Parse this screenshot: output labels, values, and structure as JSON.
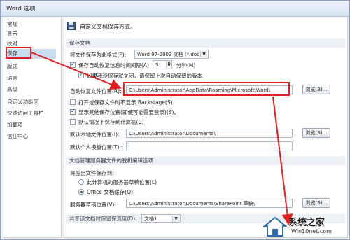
{
  "window": {
    "title": "Word 选项"
  },
  "sidebar": {
    "items": [
      {
        "label": "常规"
      },
      {
        "label": "显示"
      },
      {
        "label": "校对"
      },
      {
        "label": "保存"
      },
      {
        "label": "版式"
      },
      {
        "label": "语言"
      },
      {
        "label": "高级"
      },
      {
        "label": "自定义功能区"
      },
      {
        "label": "快速访问工具栏"
      },
      {
        "label": "加载项"
      },
      {
        "label": "信任中心"
      }
    ],
    "active_index": 3
  },
  "header": {
    "text": "自定义文档保存方式。",
    "icon": "save-icon"
  },
  "save_docs": {
    "title": "保存文档",
    "format_label": "将文件保存为此格式(F):",
    "format_value": "Word 97-2003 文档 (*.doc)",
    "autorecover_label": "保存自动恢复信息时间间隔(A)",
    "autorecover_minutes": "3",
    "minutes_unit": "分钟(M)",
    "keep_last_label": "如果我没保存就关闭，请保留上次自动保留的版本",
    "autorecover_location_label": "自动恢复文件位置(R):",
    "autorecover_location_value": "C:\\Users\\Administrator\\AppData\\Roaming\\Microsoft\\Word\\",
    "browse1": "浏览(B)...",
    "backstage_label": "打开或保存文件时不显示 Backstage(S)",
    "show_extra_label": "显示其他保存位置(即使可能需要登录)(S)。",
    "default_local_label": "默认情况下保存到计算机(C)",
    "default_local_path_label": "默认本地文件位置(I):",
    "default_local_path_value": "C:\\Users\\Administrator\\Documents\\",
    "browse2": "浏览(B)...",
    "personal_template_label": "默认个人模板位置(T):",
    "personal_template_value": ""
  },
  "offline": {
    "title": "文档管理服务器文件的脱机编辑选项",
    "checkout_label": "将签出文件保存到:",
    "option1": "此计算机的服务器草稿位置(L)",
    "option2": "Office 文档缓存(O)",
    "drafts_label": "服务器草稿位置(V):",
    "drafts_value": "C:\\Users\\Administrator\\Documents\\SharePoint 草稿\\",
    "browse3": "浏览(B)..."
  },
  "share": {
    "label": "共享该文档时保留保真度(D):",
    "doc_value": "文档1"
  },
  "annotations": {
    "color": "#e41d1d"
  },
  "watermark": {
    "brand": "系统之家",
    "site": "Win10net.com"
  }
}
